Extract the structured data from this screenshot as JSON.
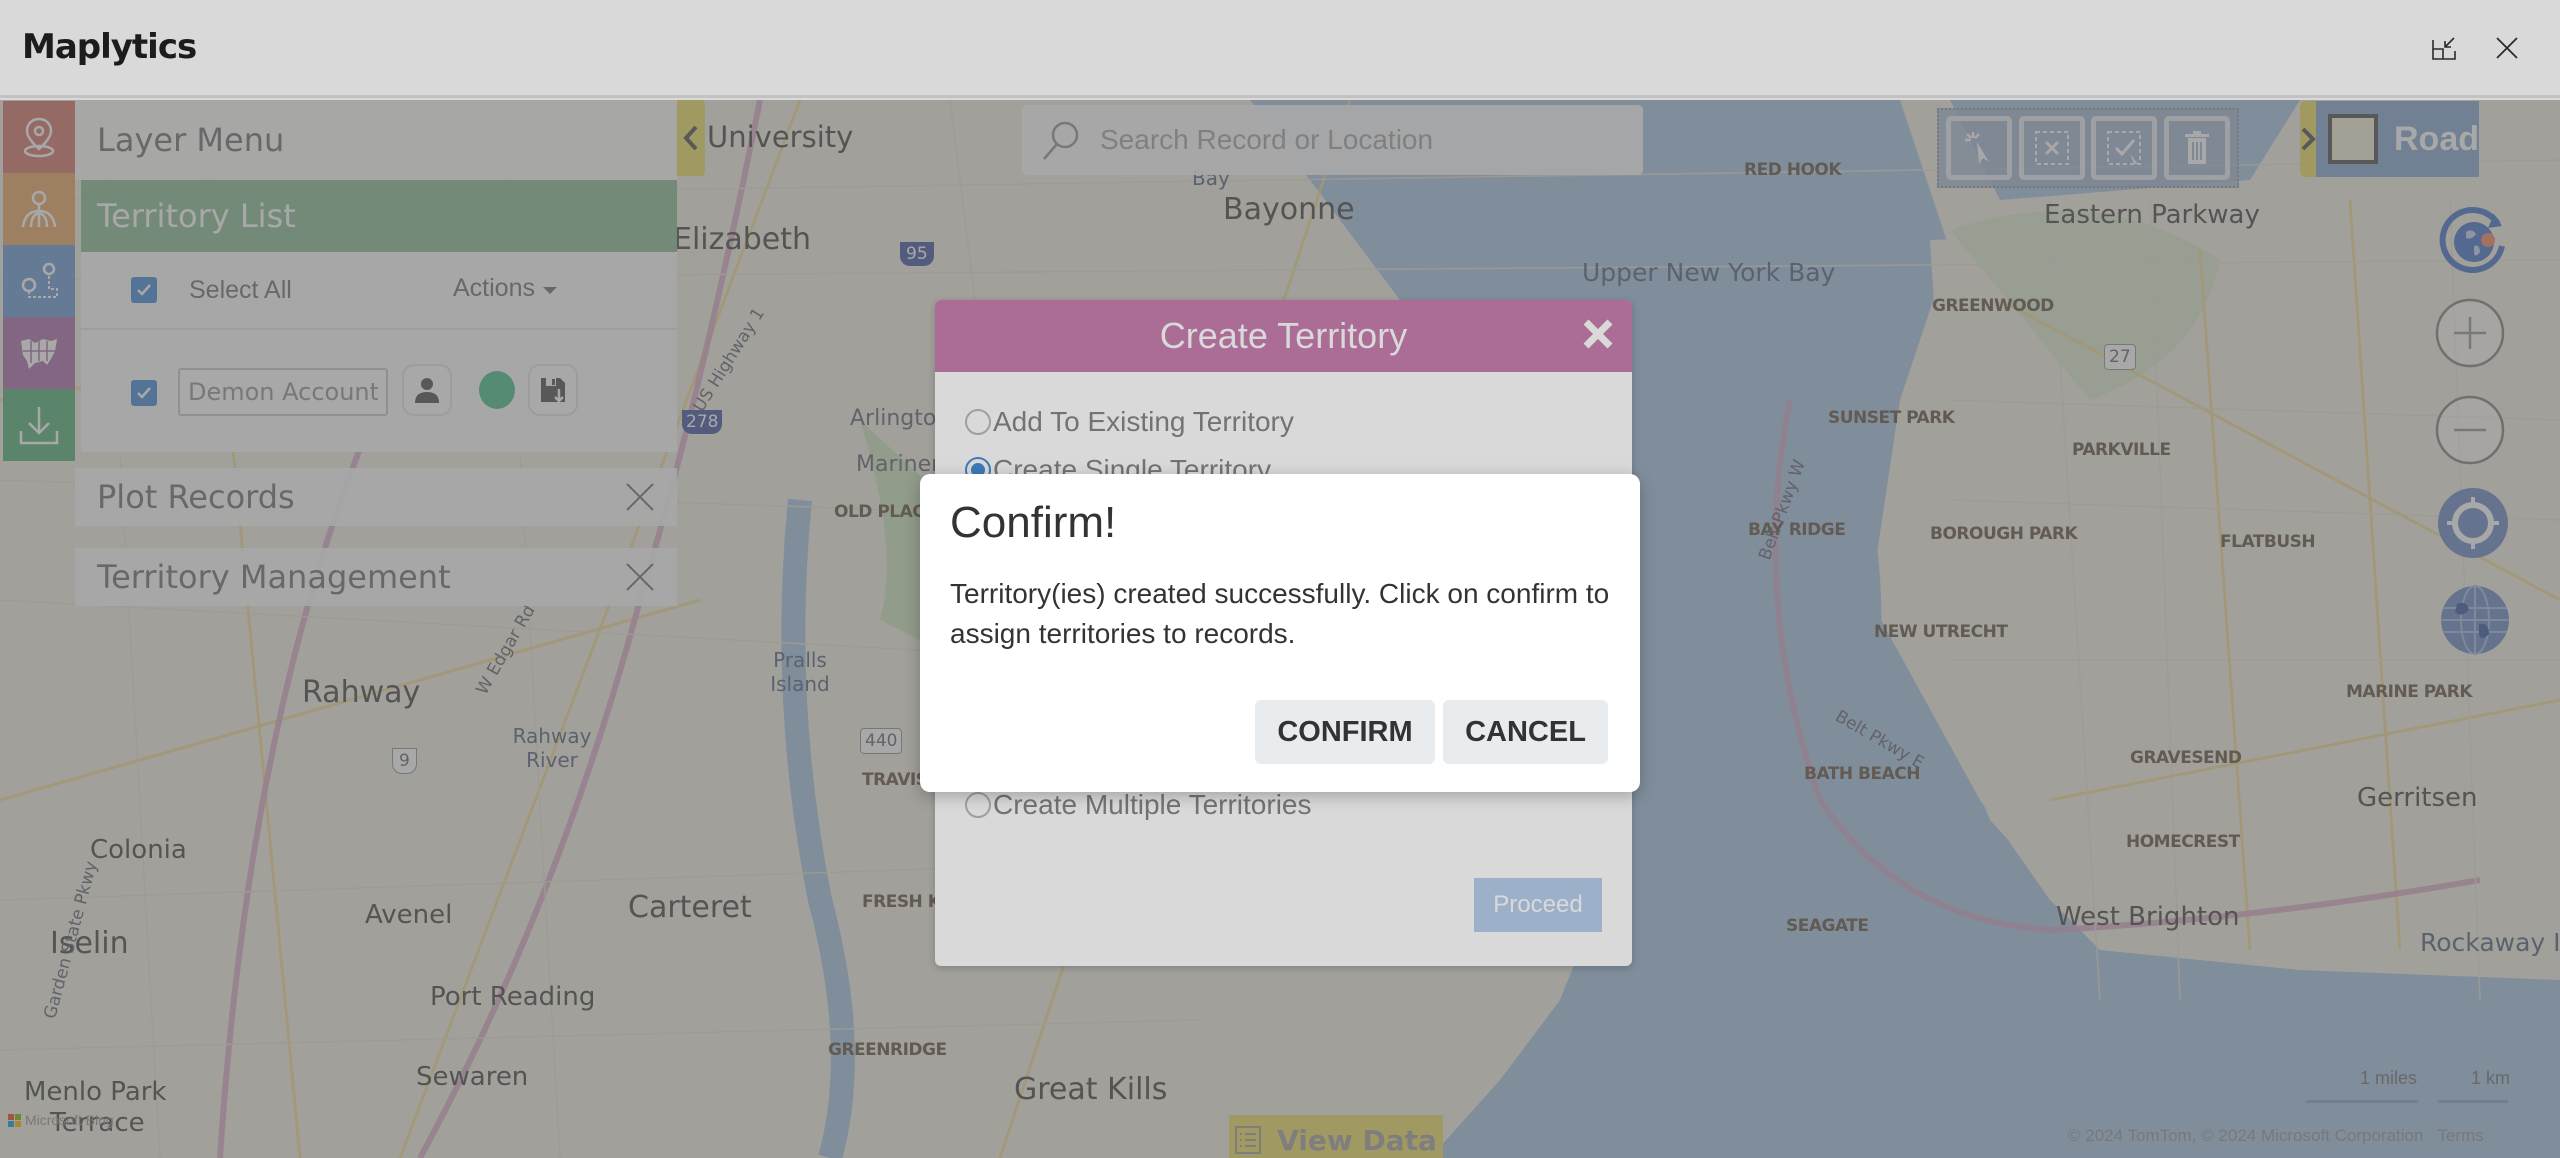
{
  "window": {
    "title": "Maplytics",
    "restore_icon": "restore-down-icon",
    "close_icon": "close-icon"
  },
  "sidebar": {
    "tiles": [
      {
        "icon": "map-pin-icon",
        "color": "#d67a6f"
      },
      {
        "icon": "territory-pin-icon",
        "color": "#e8a96a"
      },
      {
        "icon": "route-pins-icon",
        "color": "#6f9fd6"
      },
      {
        "icon": "us-map-icon",
        "color": "#b073ad"
      },
      {
        "icon": "download-icon",
        "color": "#5cb57a"
      }
    ]
  },
  "layer_panel": {
    "header": "Layer Menu",
    "territory_list": {
      "title": "Territory List",
      "select_all_label": "Select All",
      "select_all_checked": true,
      "actions_label": "Actions",
      "items": [
        {
          "name": "Demon Account",
          "checked": true,
          "color": "#4dc28f"
        }
      ]
    },
    "sections": [
      {
        "title": "Plot Records"
      },
      {
        "title": "Territory Management"
      }
    ]
  },
  "map": {
    "collapse_tab_label": "University",
    "search_placeholder": "Search Record or Location",
    "map_type_label": "Road",
    "draw_tools": [
      "select-icon",
      "clear-selection-icon",
      "confirm-selection-icon",
      "delete-icon"
    ],
    "controls": [
      "globe-refresh-icon",
      "zoom-in-icon",
      "zoom-out-icon",
      "locate-icon",
      "world-icon"
    ],
    "labels": {
      "cities": [
        "Bayonne",
        "Elizabeth",
        "Rahway",
        "Carteret",
        "Iselin",
        "Great Kills",
        "West Brighton",
        "Gerritsen"
      ],
      "towns": [
        "Colonia",
        "Avenel",
        "Port Reading",
        "Sewaren",
        "Menlo Park",
        "Terrace",
        "Eastern Parkway",
        "Arlington",
        "Mariners"
      ],
      "water": [
        "Upper New York Bay",
        "Rockaway Inlet",
        "Rahway River",
        "Pralls Island",
        "Bay"
      ],
      "neighborhoods": [
        "GREENWOOD",
        "SUNSET PARK",
        "PARKVILLE",
        "BAY RIDGE",
        "BOROUGH PARK",
        "FLATBUSH",
        "NEW UTRECHT",
        "MARINE PARK",
        "GRAVESEND",
        "BATH BEACH",
        "HOMECREST",
        "SEAGATE",
        "GREENRIDGE",
        "RED HOOK",
        "TRAVIS",
        "FRESH KILLS",
        "OLD PLACE"
      ],
      "roads": [
        "US Highway 1",
        "Garden State Pkwy",
        "Belt Pkwy W",
        "Belt Pkwy E",
        "W Edgar Rd"
      ],
      "shields": [
        "95",
        "278",
        "9",
        "440",
        "27"
      ]
    },
    "view_data_label": "View Data",
    "scale_miles": "1 miles",
    "scale_km": "1 km",
    "attribution": "© 2024 TomTom, © 2024 Microsoft Corporation",
    "terms_label": "Terms",
    "bing_label": "Microsoft Bing"
  },
  "create_territory_dialog": {
    "title": "Create Territory",
    "options": [
      {
        "label": "Add To Existing Territory",
        "selected": false
      },
      {
        "label": "Create Single Territory",
        "selected": true
      },
      {
        "label": "Create Multiple Territories",
        "selected": false
      }
    ],
    "proceed_label": "Proceed",
    "header_color": "#c97fb0"
  },
  "confirm_dialog": {
    "title": "Confirm!",
    "message": "Territory(ies) created successfully. Click on confirm to assign territories to records.",
    "confirm_label": "CONFIRM",
    "cancel_label": "CANCEL"
  }
}
